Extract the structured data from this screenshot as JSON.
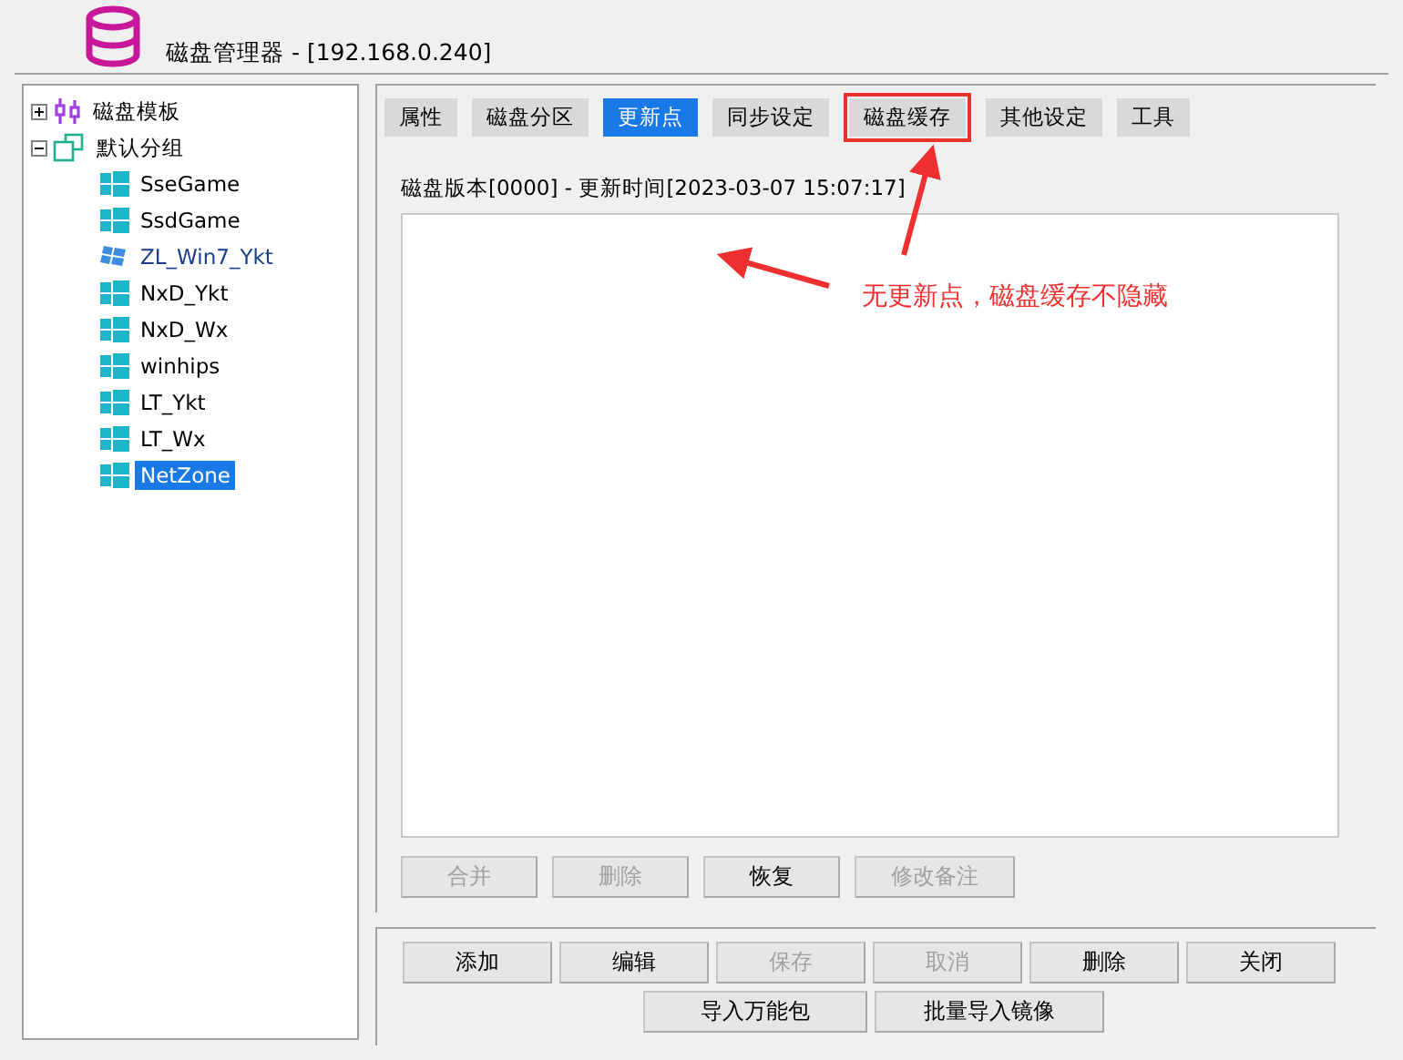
{
  "window": {
    "title": "磁盘管理器 - [192.168.0.240]"
  },
  "tree": [
    {
      "label": "磁盘模板",
      "kind": "template",
      "expanded": false,
      "selected": false
    },
    {
      "label": "默认分组",
      "kind": "group",
      "expanded": true,
      "selected": false,
      "children": [
        {
          "label": "SseGame",
          "kind": "win10",
          "selected": false
        },
        {
          "label": "SsdGame",
          "kind": "win10",
          "selected": false
        },
        {
          "label": "ZL_Win7_Ykt",
          "kind": "win7",
          "selected": false
        },
        {
          "label": "NxD_Ykt",
          "kind": "win10",
          "selected": false
        },
        {
          "label": "NxD_Wx",
          "kind": "win10",
          "selected": false
        },
        {
          "label": "winhips",
          "kind": "win10",
          "selected": false
        },
        {
          "label": "LT_Ykt",
          "kind": "win10",
          "selected": false
        },
        {
          "label": "LT_Wx",
          "kind": "win10",
          "selected": false
        },
        {
          "label": "NetZone",
          "kind": "win10",
          "selected": true
        }
      ]
    }
  ],
  "tabs": [
    {
      "label": "属性",
      "selected": false,
      "highlighted": false
    },
    {
      "label": "磁盘分区",
      "selected": false,
      "highlighted": false
    },
    {
      "label": "更新点",
      "selected": true,
      "highlighted": false
    },
    {
      "label": "同步设定",
      "selected": false,
      "highlighted": false
    },
    {
      "label": "磁盘缓存",
      "selected": false,
      "highlighted": true
    },
    {
      "label": "其他设定",
      "selected": false,
      "highlighted": false
    },
    {
      "label": "工具",
      "selected": false,
      "highlighted": false
    }
  ],
  "version_line": "磁盘版本[0000] - 更新时间[2023-03-07 15:07:17]",
  "update_buttons": [
    {
      "label": "合并",
      "disabled": true
    },
    {
      "label": "删除",
      "disabled": true
    },
    {
      "label": "恢复",
      "disabled": false
    },
    {
      "label": "修改备注",
      "disabled": true
    }
  ],
  "action_buttons": [
    {
      "label": "添加",
      "disabled": false
    },
    {
      "label": "编辑",
      "disabled": false
    },
    {
      "label": "保存",
      "disabled": true
    },
    {
      "label": "取消",
      "disabled": true
    },
    {
      "label": "删除",
      "disabled": false
    },
    {
      "label": "关闭",
      "disabled": false
    }
  ],
  "import_buttons": [
    {
      "label": "导入万能包",
      "disabled": false
    },
    {
      "label": "批量导入镜像",
      "disabled": false
    }
  ],
  "annotation": {
    "text": "无更新点，磁盘缓存不隐藏"
  }
}
